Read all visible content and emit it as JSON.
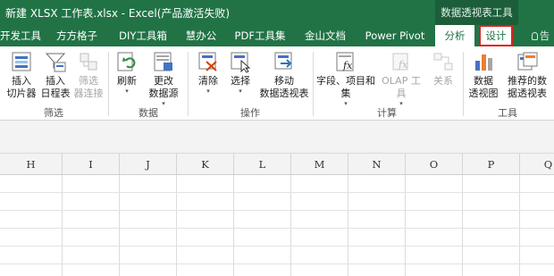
{
  "window": {
    "title": "新建 XLSX 工作表.xlsx - Excel(产品激活失败)",
    "context_tab_label": "数据透视表工具"
  },
  "tabs": [
    {
      "label": "开发工具"
    },
    {
      "label": "方方格子"
    },
    {
      "label": "DIY工具箱"
    },
    {
      "label": "慧办公"
    },
    {
      "label": "PDF工具集"
    },
    {
      "label": "金山文档"
    },
    {
      "label": "Power Pivot"
    },
    {
      "label": "分析"
    },
    {
      "label": "设计"
    },
    {
      "label": "告"
    }
  ],
  "ribbon": {
    "groups": {
      "filter": "筛选",
      "data": "数据",
      "actions": "操作",
      "calc": "计算",
      "tools": "工具"
    },
    "commands": {
      "insert_slicer": "插入\n切片器",
      "insert_timeline": "插入\n日程表",
      "filter_connections": "筛选\n器连接",
      "refresh": "刷新",
      "change_source": "更改\n数据源",
      "clear": "清除",
      "select": "选择",
      "move_pivot": "移动\n数据透视表",
      "fields_items": "字段、项目和\n集",
      "olap_tools": "OLAP 工具",
      "relationships": "关系",
      "pivot_chart": "数据\n透视图",
      "recommended": "推荐的数\n据透视表"
    },
    "dropdown_glyph": "▾"
  },
  "sheet": {
    "columns": [
      "H",
      "I",
      "J",
      "K",
      "L",
      "M",
      "N",
      "O",
      "P",
      "Q"
    ]
  },
  "colors": {
    "excel_green": "#217346",
    "context_green": "#1b5e39",
    "highlight_red": "#e0201b"
  }
}
